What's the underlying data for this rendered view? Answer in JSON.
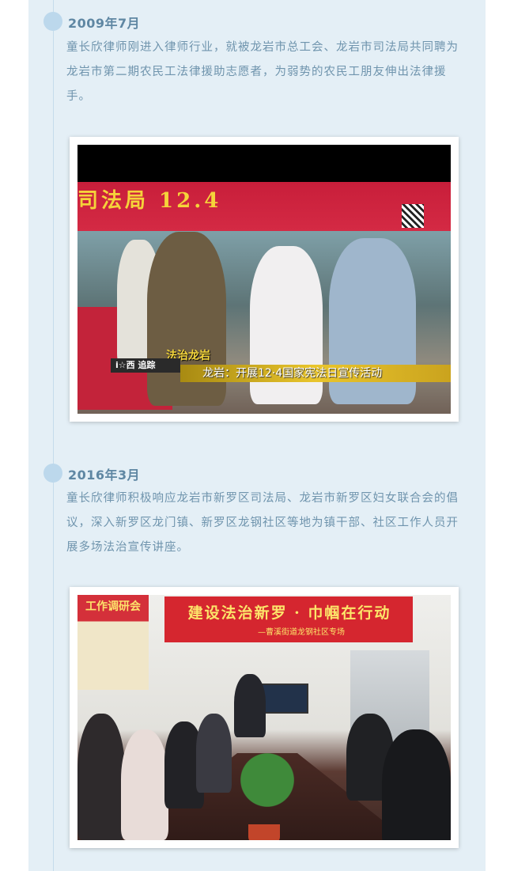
{
  "timeline": [
    {
      "date": "2009年7月",
      "description": "童长欣律师刚进入律师行业，就被龙岩市总工会、龙岩市司法局共同聘为龙岩市第二期农民工法律援助志愿者，为弱势的农民工朋友伸出法律援手。",
      "photo": {
        "tent_text": "司法局  12.4",
        "logo_text": "i☆西 追踪",
        "caption_small": "法治龙岩",
        "caption_banner": "龙岩：开展12·4国家宪法日宣传活动"
      }
    },
    {
      "date": "2016年3月",
      "description": "童长欣律师积极响应龙岩市新罗区司法局、龙岩市新罗区妇女联合会的倡议，深入新罗区龙门镇、新罗区龙钢社区等地为镇干部、社区工作人员开展多场法治宣传讲座。",
      "photo": {
        "left_banner_text": "工作调研会",
        "banner_text": "建设法治新罗 · 巾帼在行动",
        "banner_subtitle": "—曹溪街道龙钢社区专场"
      }
    }
  ],
  "colors": {
    "panel_bg": "#e4eff6",
    "date_text": "#5f87a3",
    "body_text": "#6f94ad",
    "dot": "#bcd8ec"
  }
}
